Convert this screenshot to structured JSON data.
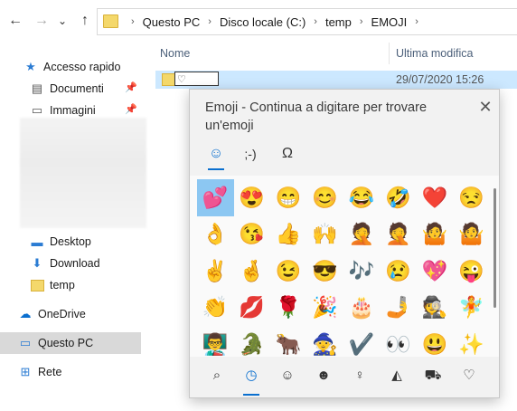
{
  "address_bar": {
    "back": "←",
    "forward": "→",
    "recent": "⌄",
    "up": "↑",
    "breadcrumbs": [
      "Questo PC",
      "Disco locale (C:)",
      "temp",
      "EMOJI"
    ],
    "separator": "›"
  },
  "columns": {
    "name": "Nome",
    "modified": "Ultima modifica"
  },
  "sidebar": {
    "items": [
      {
        "label": "Accesso rapido",
        "icon": "star-icon",
        "glyph": "★"
      },
      {
        "label": "Documenti",
        "icon": "document-icon",
        "glyph": "▤",
        "pinned": "📌"
      },
      {
        "label": "Immagini",
        "icon": "image-icon",
        "glyph": "▭",
        "pinned": "📌"
      },
      {
        "label": "Desktop",
        "icon": "desktop-icon",
        "glyph": "▬"
      },
      {
        "label": "Download",
        "icon": "download-icon",
        "glyph": "⬇"
      },
      {
        "label": "temp",
        "icon": "folder-icon",
        "glyph": ""
      },
      {
        "label": "OneDrive",
        "icon": "cloud-icon",
        "glyph": "☁"
      },
      {
        "label": "Questo PC",
        "icon": "computer-icon",
        "glyph": "▭"
      },
      {
        "label": "Rete",
        "icon": "network-icon",
        "glyph": "⊞"
      }
    ]
  },
  "file": {
    "rename_value": "♡",
    "modified": "29/07/2020 15:26"
  },
  "emoji_panel": {
    "title": "Emoji - Continua a digitare per trovare un'emoji",
    "close": "✕",
    "tabs": [
      {
        "name": "emoji-tab",
        "glyph": "☺"
      },
      {
        "name": "kaomoji-tab",
        "glyph": ";-)"
      },
      {
        "name": "symbols-tab",
        "glyph": "Ω"
      }
    ],
    "emojis": [
      "💕",
      "😍",
      "😁",
      "😊",
      "😂",
      "🤣",
      "❤️",
      "😒",
      "👌",
      "😘",
      "👍",
      "🙌",
      "🤦",
      "🤦",
      "🤷",
      "🤷",
      "✌️",
      "🤞",
      "😉",
      "😎",
      "🎶",
      "😢",
      "💖",
      "😜",
      "👏",
      "💋",
      "🌹",
      "🎉",
      "🎂",
      "🤳",
      "🕵️",
      "🧚",
      "👨‍🏫",
      "🐊",
      "🐂",
      "🧙",
      "✔️",
      "👀",
      "😃",
      "✨"
    ],
    "categories": [
      {
        "name": "search-icon",
        "glyph": "⌕"
      },
      {
        "name": "recent-icon",
        "glyph": "◷"
      },
      {
        "name": "smiley-icon",
        "glyph": "☺"
      },
      {
        "name": "people-icon",
        "glyph": "☻"
      },
      {
        "name": "celebration-icon",
        "glyph": "♀"
      },
      {
        "name": "food-icon",
        "glyph": "◭"
      },
      {
        "name": "vehicle-icon",
        "glyph": "⛟"
      },
      {
        "name": "heart-icon",
        "glyph": "♡"
      }
    ]
  },
  "colors": {
    "selection": "#cce8ff",
    "accent": "#0a6fcf",
    "emoji_selected": "#8cc7f2"
  }
}
